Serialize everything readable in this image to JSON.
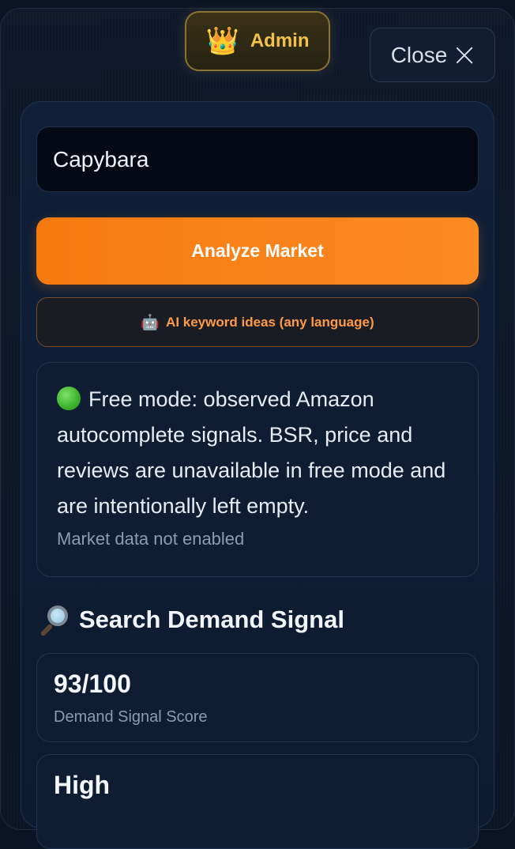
{
  "header": {
    "admin_icon": "crown-icon",
    "admin_label": "Admin",
    "close_label": "Close",
    "close_icon": "close-icon"
  },
  "search": {
    "value": "Capybara"
  },
  "actions": {
    "analyze_label": "Analyze Market",
    "ai_icon": "robot-icon",
    "ai_label": "AI keyword ideas (any language)"
  },
  "info": {
    "status_icon": "green-circle-icon",
    "message": "Free mode: observed Amazon autocomplete signals. BSR, price and reviews are unavailable in free mode and are intentionally left empty.",
    "note": "Market data not enabled"
  },
  "demand": {
    "icon": "magnifying-glass-icon",
    "title": "Search Demand Signal",
    "cards": [
      {
        "value": "93/100",
        "label": "Demand Signal Score"
      },
      {
        "value": "High",
        "label": ""
      }
    ]
  },
  "colors": {
    "accent_orange": "#f77a10",
    "admin_gold": "#f4c24a",
    "background": "#0b1424"
  }
}
